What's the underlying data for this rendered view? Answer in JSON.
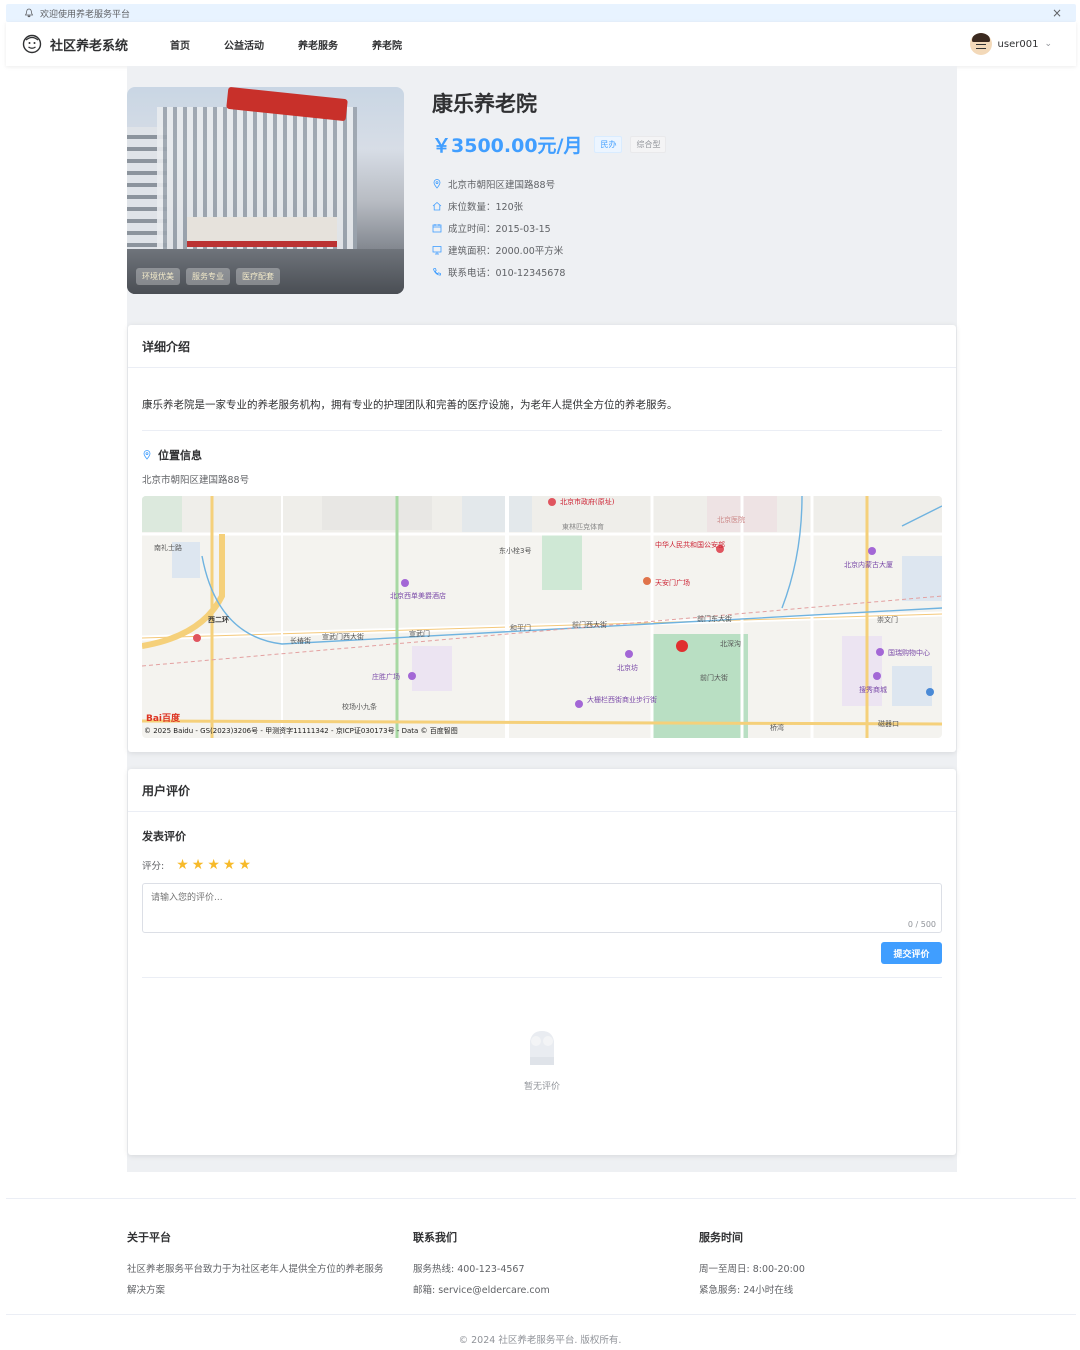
{
  "notice": {
    "text": "欢迎使用养老服务平台",
    "close": "×"
  },
  "nav": {
    "logo": "社区养老系统",
    "links": [
      "首页",
      "公益活动",
      "养老服务",
      "养老院"
    ],
    "user": "user001"
  },
  "hero": {
    "tags": [
      "环境优美",
      "服务专业",
      "医疗配套"
    ],
    "title": "康乐养老院",
    "price": "￥3500.00元/月",
    "badges": [
      "民办",
      "综合型"
    ],
    "info": [
      {
        "icon": "location-icon",
        "text": "北京市朝阳区建国路88号"
      },
      {
        "icon": "home-icon",
        "text": "床位数量：120张"
      },
      {
        "icon": "calendar-icon",
        "text": "成立时间：2015-03-15"
      },
      {
        "icon": "monitor-icon",
        "text": "建筑面积：2000.00平方米"
      },
      {
        "icon": "phone-icon",
        "text": "联系电话：010-12345678"
      }
    ]
  },
  "detail": {
    "header": "详细介绍",
    "description": "康乐养老院是一家专业的养老服务机构，拥有专业的护理团队和完善的医疗设施，为老年人提供全方位的养老服务。",
    "location_title": "位置信息",
    "location_addr": "北京市朝阳区建国路88号",
    "map_credit": "© 2025 Baidu - GS(2023)3206号 - 甲测资字11111342 - 京ICP证030173号 - Data © 百度智图",
    "map_logo": "Bai百度",
    "map_labels": [
      "南礼士路",
      "东小栓3号",
      "中华人民共和国公安部",
      "北京内蒙古大厦",
      "天安门广场",
      "北京西单美爵酒店",
      "和平门",
      "前门西大街",
      "前门东大街",
      "崇文门",
      "长椿街",
      "宣武门西大街",
      "宣武门",
      "北京坊",
      "北深沟",
      "国瑞购物中心",
      "庄胜广场",
      "前门大街",
      "搜秀商城",
      "校场小九条",
      "大栅栏西街商业步行街",
      "磁器口",
      "桥湾",
      "北京医院",
      "西二环",
      "北京市政府(原址)",
      "東林匹克体育"
    ]
  },
  "reviews": {
    "header": "用户评价",
    "sub_title": "发表评价",
    "rating_label": "评分:",
    "rating": 5,
    "placeholder": "请输入您的评价...",
    "count": "0 / 500",
    "submit": "提交评价",
    "empty": "暂无评价"
  },
  "footer": {
    "about_title": "关于平台",
    "about_text": "社区养老服务平台致力于为社区老年人提供全方位的养老服务解决方案",
    "contact_title": "联系我们",
    "contact_phone": "服务热线: 400-123-4567",
    "contact_email": "邮箱: service@eldercare.com",
    "time_title": "服务时间",
    "time_week": "周一至周日: 8:00-20:00",
    "time_emergency": "紧急服务: 24小时在线",
    "copyright": "© 2024 社区养老服务平台. 版权所有."
  },
  "colors": {
    "primary": "#409eff",
    "star": "#f7ba2a",
    "price": "#409eff"
  }
}
